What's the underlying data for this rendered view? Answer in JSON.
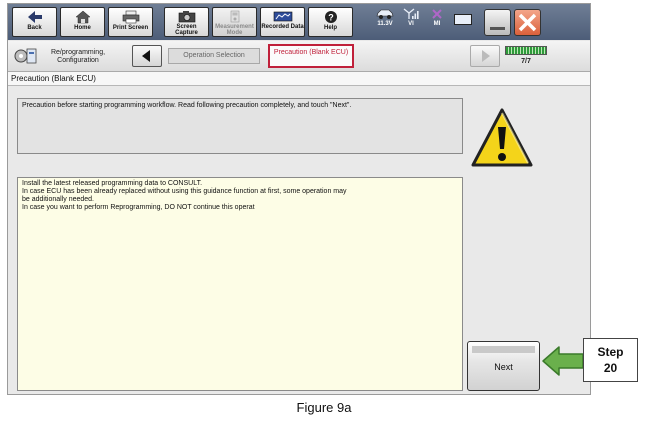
{
  "toolbar": {
    "back_label": "Back",
    "home_label": "Home",
    "print_label": "Print Screen",
    "capture_label": "Screen Capture",
    "measure_label": "Measurement Mode",
    "recorded_label": "Recorded Data",
    "help_label": "Help"
  },
  "status": {
    "battery_voltage": "11.3V",
    "vi_label": "VI",
    "mi_label": "MI"
  },
  "breadcrumb": {
    "step1_label": "Re/programming, Configuration",
    "step2_label": "Operation Selection",
    "step3_label": "Precaution (Blank ECU)",
    "progress": "7/7"
  },
  "page": {
    "title": "Precaution (Blank ECU)",
    "intro_text": "Precaution before starting programming workflow. Read following precaution completely, and touch \"Next\".",
    "lines": [
      "Install the latest released programming data to CONSULT.",
      "In case ECU has been already replaced without using this guidance function at first, some operation may",
      "be additionally needed.",
      "In case you want to perform Reprogramming, DO NOT continue this operat"
    ],
    "next_label": "Next"
  },
  "callout": {
    "step_line1": "Step",
    "step_line2": "20"
  },
  "caption": "Figure 9a",
  "colors": {
    "toolbar_bg": "#5a6a85",
    "content_bg": "#fdfde6",
    "intro_bg": "#e3e3e3",
    "active_crumb_border": "#c0203a",
    "warning_yellow": "#f4d41a",
    "arrow_green": "#6ab04c"
  }
}
